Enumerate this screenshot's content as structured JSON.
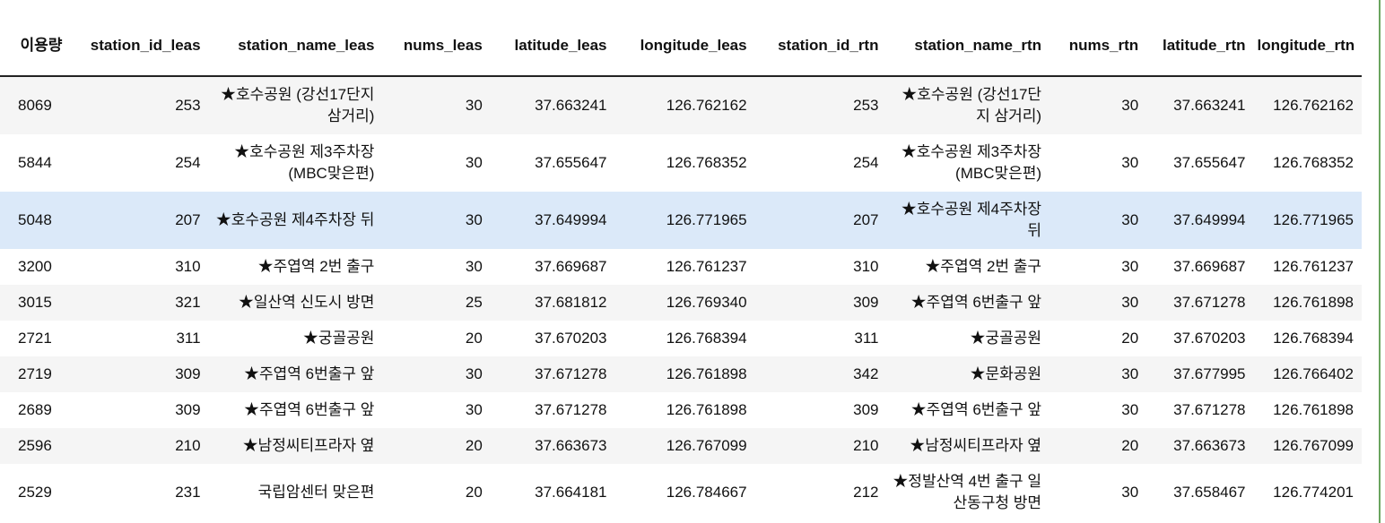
{
  "table": {
    "columns": [
      "이용량",
      "station_id_leas",
      "station_name_leas",
      "nums_leas",
      "latitude_leas",
      "longitude_leas",
      "station_id_rtn",
      "station_name_rtn",
      "nums_rtn",
      "latitude_rtn",
      "longitude_rtn"
    ],
    "rows": [
      [
        "8069",
        "253",
        "★호수공원 (강선17단지 삼거리)",
        "30",
        "37.663241",
        "126.762162",
        "253",
        "★호수공원 (강선17단지 삼거리)",
        "30",
        "37.663241",
        "126.762162"
      ],
      [
        "5844",
        "254",
        "★호수공원 제3주차장 (MBC맞은편)",
        "30",
        "37.655647",
        "126.768352",
        "254",
        "★호수공원 제3주차장 (MBC맞은편)",
        "30",
        "37.655647",
        "126.768352"
      ],
      [
        "5048",
        "207",
        "★호수공원 제4주차장 뒤",
        "30",
        "37.649994",
        "126.771965",
        "207",
        "★호수공원 제4주차장 뒤",
        "30",
        "37.649994",
        "126.771965"
      ],
      [
        "3200",
        "310",
        "★주엽역 2번 출구",
        "30",
        "37.669687",
        "126.761237",
        "310",
        "★주엽역 2번 출구",
        "30",
        "37.669687",
        "126.761237"
      ],
      [
        "3015",
        "321",
        "★일산역 신도시 방면",
        "25",
        "37.681812",
        "126.769340",
        "309",
        "★주엽역 6번출구 앞",
        "30",
        "37.671278",
        "126.761898"
      ],
      [
        "2721",
        "311",
        "★궁골공원",
        "20",
        "37.670203",
        "126.768394",
        "311",
        "★궁골공원",
        "20",
        "37.670203",
        "126.768394"
      ],
      [
        "2719",
        "309",
        "★주엽역 6번출구 앞",
        "30",
        "37.671278",
        "126.761898",
        "342",
        "★문화공원",
        "30",
        "37.677995",
        "126.766402"
      ],
      [
        "2689",
        "309",
        "★주엽역 6번출구 앞",
        "30",
        "37.671278",
        "126.761898",
        "309",
        "★주엽역 6번출구 앞",
        "30",
        "37.671278",
        "126.761898"
      ],
      [
        "2596",
        "210",
        "★남정씨티프라자 옆",
        "20",
        "37.663673",
        "126.767099",
        "210",
        "★남정씨티프라자 옆",
        "20",
        "37.663673",
        "126.767099"
      ],
      [
        "2529",
        "231",
        "국립암센터 맞은편",
        "20",
        "37.664181",
        "126.784667",
        "212",
        "★정발산역 4번 출구 일산동구청 방면",
        "30",
        "37.658467",
        "126.774201"
      ]
    ]
  },
  "colors": {
    "row_stripe": "#f5f5f5",
    "row_hover": "#dbe9f9",
    "frame_border": "#6aa55f"
  }
}
